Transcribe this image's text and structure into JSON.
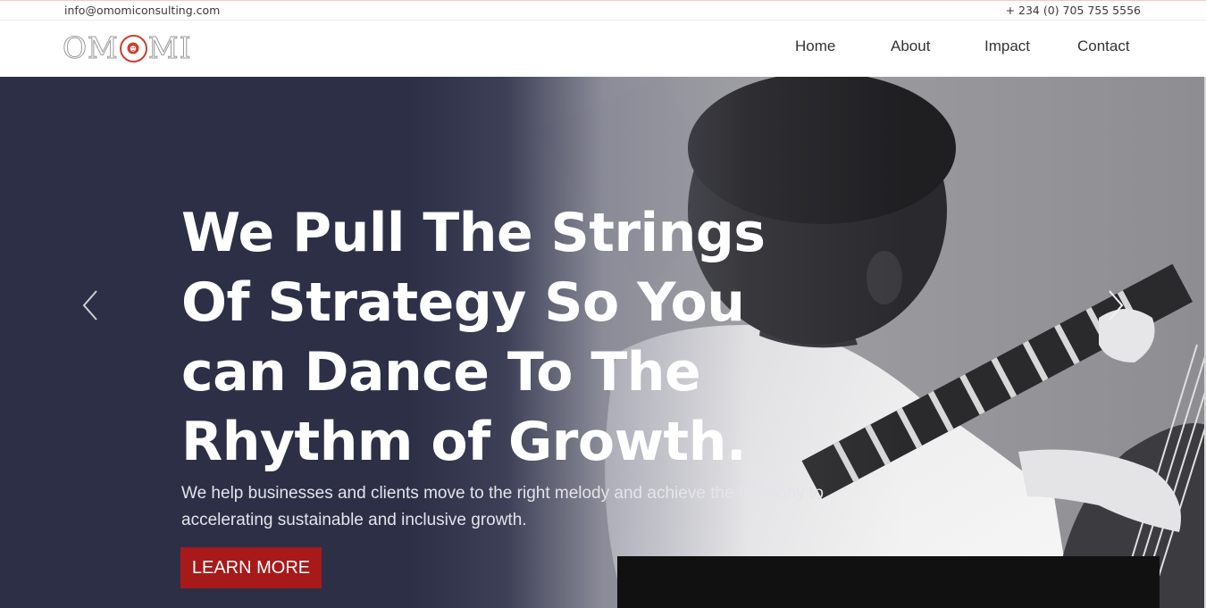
{
  "topbar": {
    "email": "info@omomiconsulting.com",
    "phone": "+ 234 (0) 705 755 5556"
  },
  "brand": {
    "logo_left": "OM",
    "logo_right": "MI",
    "logo_text": "OMOMI",
    "accent_color": "#c9412f"
  },
  "nav": {
    "items": [
      {
        "label": "Home"
      },
      {
        "label": "About"
      },
      {
        "label": "Impact"
      },
      {
        "label": "Contact"
      }
    ]
  },
  "hero": {
    "title": "We Pull The Strings Of Strategy So You can Dance To The Rhythm of Growth.",
    "subtitle": "We help businesses and clients move to the right melody and achieve the harmony to accelerating sustainable and inclusive growth.",
    "cta_label": "LEARN MORE",
    "cta_color": "#a8191a",
    "background_color": "#2d2f47",
    "prev_icon": "chevron-left-icon",
    "next_icon": "chevron-right-icon"
  }
}
